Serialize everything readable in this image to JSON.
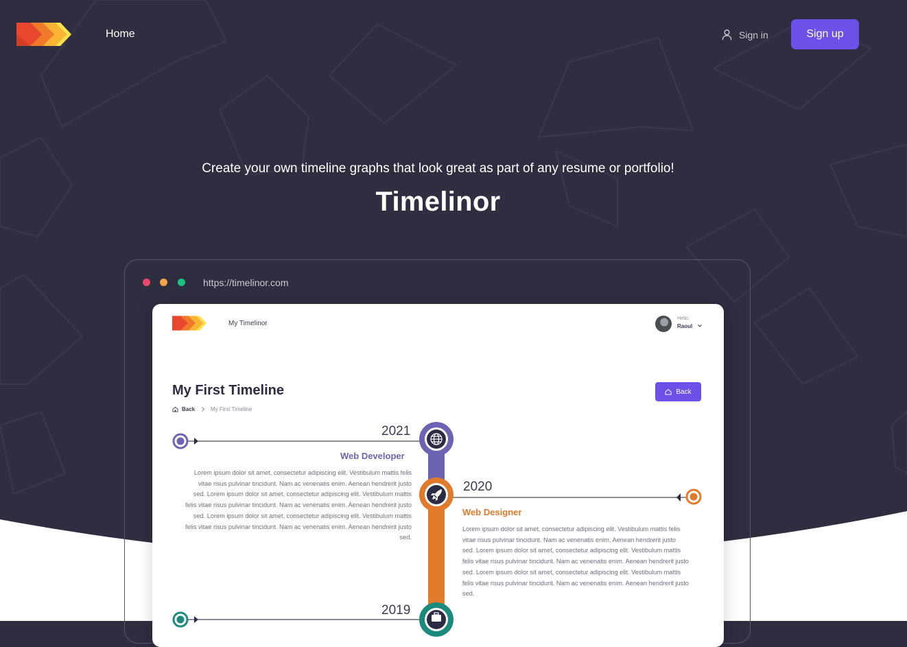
{
  "nav": {
    "home_label": "Home",
    "signin_label": "Sign in",
    "signup_label": "Sign up"
  },
  "hero": {
    "subtitle": "Create your own timeline graphs that look great as part of any resume or portfolio!",
    "title": "Timelinor"
  },
  "browser": {
    "url": "https://timelinor.com",
    "dot_colors": [
      "#e9476b",
      "#f5a346",
      "#1fbf84"
    ]
  },
  "app": {
    "nav_label": "My Timelinor",
    "greeting": "Hello,",
    "user_name": "Raoul",
    "timeline_title": "My First Timeline",
    "breadcrumb_back": "Back",
    "breadcrumb_current": "My First Timeline",
    "back_button": "Back",
    "entries": [
      {
        "year": "2021",
        "role": "Web Developer",
        "color": "#6d63b3",
        "icon": "globe-icon",
        "description": "Lorem ipsum dolor sit amet, consectetur adipiscing elit. Vestibulum mattis felis vitae risus pulvinar tincidunt. Nam ac venenatis enim. Aenean hendrerit justo sed. Lorem ipsum dolor sit amet, consectetur adipiscing elit. Vestibulum mattis felis vitae risus pulvinar tincidunt. Nam ac venenatis enim. Aenean hendrerit justo sed. Lorem ipsum dolor sit amet, consectetur adipiscing elit. Vestibulum mattis felis vitae risus pulvinar tincidunt. Nam ac venenatis enim. Aenean hendrerit justo sed."
      },
      {
        "year": "2020",
        "role": "Web Designer",
        "color": "#e27a2c",
        "icon": "rocket-icon",
        "description": "Lorem ipsum dolor sit amet, consectetur adipiscing elit. Vestibulum mattis felis vitae risus pulvinar tincidunt. Nam ac venenatis enim. Aenean hendrerit justo sed. Lorem ipsum dolor sit amet, consectetur adipiscing elit. Vestibulum mattis felis vitae risus pulvinar tincidunt. Nam ac venenatis enim. Aenean hendrerit justo sed. Lorem ipsum dolor sit amet, consectetur adipiscing elit. Vestibulum mattis felis vitae risus pulvinar tincidunt. Nam ac venenatis enim. Aenean hendrerit justo sed."
      },
      {
        "year": "2019",
        "role": "",
        "color": "#1a8a7d",
        "icon": "briefcase-icon",
        "description": ""
      }
    ]
  },
  "colors": {
    "background": "#2f2d40",
    "accent": "#6c50e8"
  }
}
